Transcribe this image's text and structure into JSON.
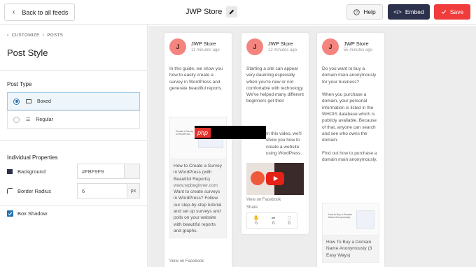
{
  "topbar": {
    "back_label": "Back to all feeds",
    "feed_title": "JWP Store",
    "help_label": "Help",
    "embed_label": "Embed",
    "save_label": "Save"
  },
  "sidebar": {
    "breadcrumb": [
      "CUSTOMIZE",
      "POSTS"
    ],
    "title": "Post Style",
    "post_type_label": "Post Type",
    "post_types": [
      {
        "label": "Boxed",
        "selected": true
      },
      {
        "label": "Regular",
        "selected": false
      }
    ],
    "individual_label": "Individual Properties",
    "background_label": "Background",
    "background_value": "#FBF9F9",
    "border_radius_label": "Border Radius",
    "border_radius_value": "6",
    "border_radius_unit": "px",
    "box_shadow_label": "Box Shadow",
    "box_shadow_checked": true
  },
  "preview": {
    "cards": [
      {
        "avatar": "J",
        "name": "JWP Store",
        "time": "11 minutes ago",
        "text": "In this guide, we show you how to easily create a survey in WordPress and generate beautiful reports.",
        "link_thumb_caption": "Create a Survey in WordPress",
        "link_title": "How to Create a Survey in WordPress (with Beautiful Reports)",
        "link_domain": "www.wpbeginner.com",
        "link_desc": "Want to create surveys in WordPress? Follow our step-by-step tutorial and set up surveys and polls on your website with beautiful reports and graphs.",
        "view_label": "View on Facebook"
      },
      {
        "avatar": "J",
        "name": "JWP Store",
        "time": "12 minutes ago",
        "text_top": "Starting a site can appear very daunting especially when you're new or not comfortable with technology. We've helped many different beginners get their",
        "text_bottom": "In this video, we'll show you how to create a website using WordPress.",
        "view_label": "View on Facebook",
        "share_label": "Share",
        "stats": [
          "0",
          "0",
          "0"
        ]
      },
      {
        "avatar": "J",
        "name": "JWP Store",
        "time": "55 minutes ago",
        "text": "Do you want to buy a domain main anonymously for your business?\n\nWhen you purchase a domain, your personal information is listed in the WHOIS database which is publicly available. Because of that, anyone can search and see who owns the domain.\n\nFind out how to purchase a domain main anonymously.",
        "link_thumb_caption": "How to Buy a Domain Name Anonymously",
        "link_title": "How To Buy a Domain Name Anonymously (3 Easy Ways)"
      }
    ],
    "watermark": "php"
  }
}
